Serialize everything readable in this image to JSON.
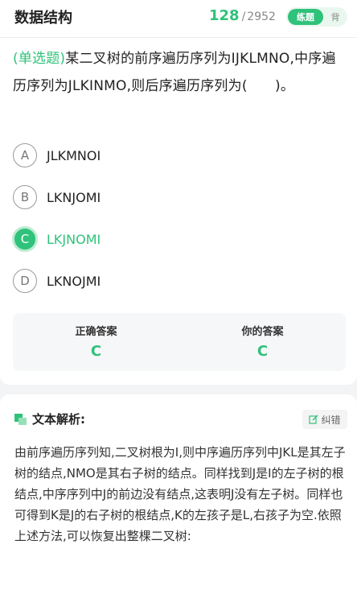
{
  "header": {
    "title": "数据结构",
    "current": "128",
    "separator": "/",
    "total": "2952",
    "mode_active": "练题",
    "mode_inactive": "背"
  },
  "question": {
    "type_label": "(单选题)",
    "text": "某二叉树的前序遍历序列为IJKLMNO,中序遍历序列为JLKINMO,则后序遍历序列为(　　)。"
  },
  "options": [
    {
      "letter": "A",
      "text": "JLKMNOI"
    },
    {
      "letter": "B",
      "text": "LKNJOMI"
    },
    {
      "letter": "C",
      "text": "LKJNOMI"
    },
    {
      "letter": "D",
      "text": "LKNOJMI"
    }
  ],
  "selected_option": "C",
  "answers": {
    "correct_label": "正确答案",
    "correct_value": "C",
    "yours_label": "你的答案",
    "yours_value": "C"
  },
  "analysis": {
    "title": "文本解析:",
    "correct_button": "纠错",
    "text": "由前序遍历序列知,二叉树根为I,则中序遍历序列中JKL是其左子树的结点,NMO是其右子树的结点。同样找到J是I的左子树的根结点,中序序列中J的前边没有结点,这表明J没有左子树。同样也可得到K是J的右子树的根结点,K的左孩子是L,右孩子为空.依照上述方法,可以恢复出整棵二叉树:"
  },
  "colors": {
    "accent": "#2fc27a",
    "accent_light": "#e9f7ef"
  }
}
